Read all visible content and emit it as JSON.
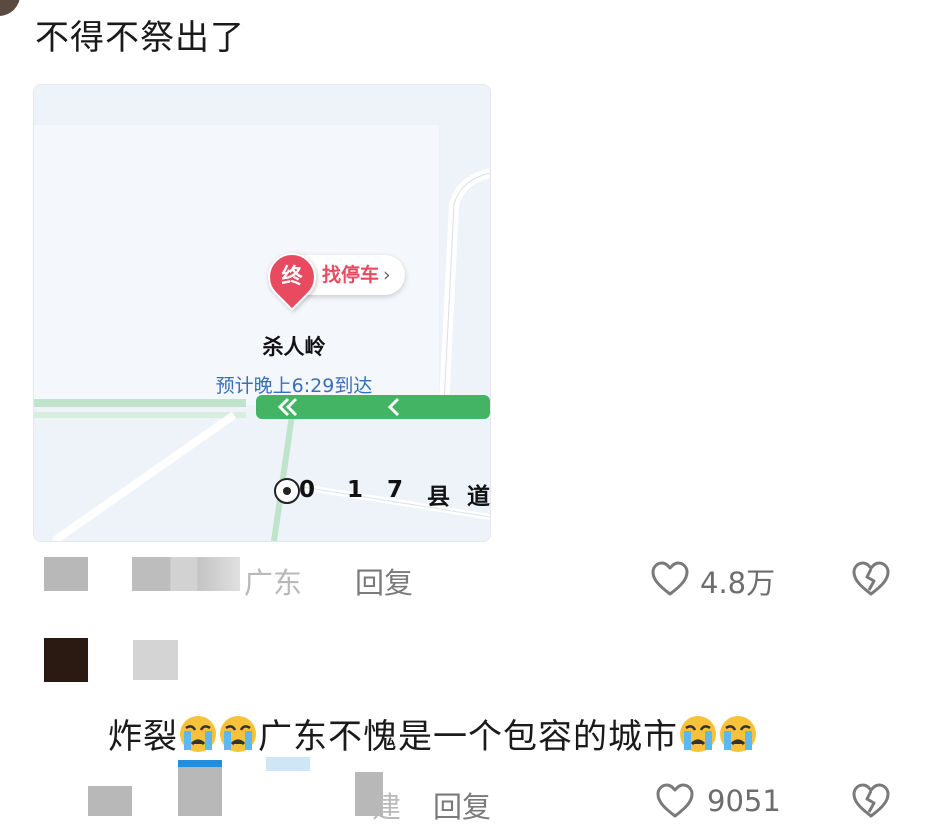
{
  "comment1": {
    "text": "不得不祭出了",
    "map": {
      "action": "找停车",
      "marker": "终",
      "destination": "杀人岭",
      "eta": "预计晚上6:29到达",
      "road_chars": [
        "0",
        "1",
        "7",
        "县",
        "道"
      ]
    },
    "location": "广东",
    "reply_label": "回复",
    "likes": "4.8万"
  },
  "comment2": {
    "text_parts": [
      "炸裂",
      "广东不愧是一个包容的城市"
    ],
    "emoji": "crying-face",
    "location_fragment": "建",
    "reply_label": "回复",
    "likes": "9051"
  }
}
